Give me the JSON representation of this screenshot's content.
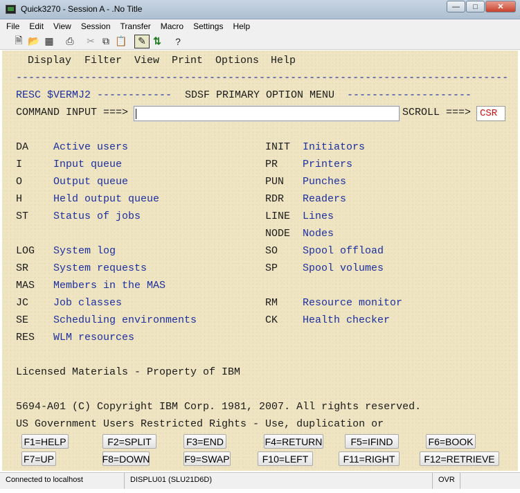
{
  "window": {
    "title": "Quick3270 - Session A - .No Title"
  },
  "menubar": [
    "File",
    "Edit",
    "View",
    "Session",
    "Transfer",
    "Macro",
    "Settings",
    "Help"
  ],
  "terminal": {
    "action_bar": [
      "Display",
      "Filter",
      "View",
      "Print",
      "Options",
      "Help"
    ],
    "header_left": "RESC $VERMJ2",
    "header_title": "SDSF PRIMARY OPTION MENU",
    "command_label": "COMMAND INPUT ===>",
    "command_value": "",
    "scroll_label": "SCROLL ===>",
    "scroll_value": "CSR",
    "options_left": [
      {
        "code": "DA",
        "desc": "Active users"
      },
      {
        "code": "I",
        "desc": "Input queue"
      },
      {
        "code": "O",
        "desc": "Output queue"
      },
      {
        "code": "H",
        "desc": "Held output queue"
      },
      {
        "code": "ST",
        "desc": "Status of jobs"
      },
      {
        "code": "LOG",
        "desc": "System log"
      },
      {
        "code": "SR",
        "desc": "System requests"
      },
      {
        "code": "MAS",
        "desc": "Members in the MAS"
      },
      {
        "code": "JC",
        "desc": "Job classes"
      },
      {
        "code": "SE",
        "desc": "Scheduling environments"
      },
      {
        "code": "RES",
        "desc": "WLM resources"
      }
    ],
    "options_right": [
      {
        "code": "INIT",
        "desc": "Initiators"
      },
      {
        "code": "PR",
        "desc": "Printers"
      },
      {
        "code": "PUN",
        "desc": "Punches"
      },
      {
        "code": "RDR",
        "desc": "Readers"
      },
      {
        "code": "LINE",
        "desc": "Lines"
      },
      {
        "code": "NODE",
        "desc": "Nodes"
      },
      {
        "code": "SO",
        "desc": "Spool offload"
      },
      {
        "code": "SP",
        "desc": "Spool volumes"
      },
      {
        "code": "RM",
        "desc": "Resource monitor"
      },
      {
        "code": "CK",
        "desc": "Health checker"
      }
    ],
    "licensed": "Licensed Materials - Property of IBM",
    "copyright": "5694-A01 (C) Copyright IBM Corp. 1981, 2007. All rights reserved.",
    "restricted": "US Government Users Restricted Rights - Use, duplication or"
  },
  "fkeys": [
    "F1=HELP",
    "F2=SPLIT",
    "F3=END",
    "F4=RETURN",
    "F5=IFIND",
    "F6=BOOK",
    "F7=UP",
    "F8=DOWN",
    "F9=SWAP",
    "F10=LEFT",
    "F11=RIGHT",
    "F12=RETRIEVE"
  ],
  "statusbar": {
    "connection": "Connected to localhost",
    "lu": "DISPLU01 (SLU21D6D)",
    "mode": "OVR"
  },
  "icons": [
    "app-terminal-icon",
    "new-file-icon",
    "open-folder-icon",
    "save-icon",
    "print-icon",
    "cut-icon",
    "copy-icon",
    "paste-icon",
    "edit-session-icon",
    "transfer-icon",
    "help-icon"
  ]
}
